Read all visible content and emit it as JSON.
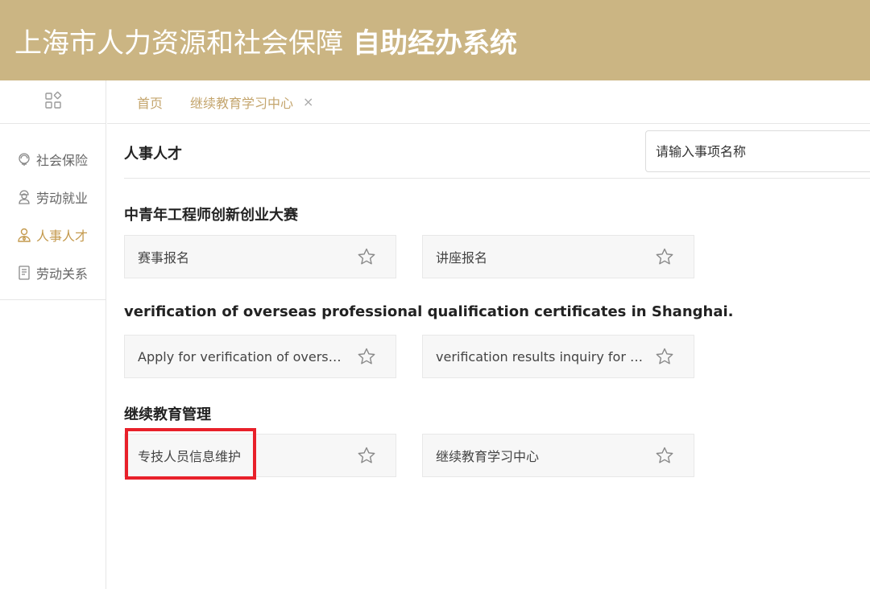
{
  "header": {
    "title_main": "上海市人力资源和社会保障",
    "title_bold": "自助经办系统"
  },
  "sidebar": {
    "top_icon": "grid-apps-icon",
    "items": [
      {
        "label": "社会保险",
        "icon": "insurance-icon",
        "active": false
      },
      {
        "label": "劳动就业",
        "icon": "worker-icon",
        "active": false
      },
      {
        "label": "人事人才",
        "icon": "person-icon",
        "active": true
      },
      {
        "label": "劳动关系",
        "icon": "document-icon",
        "active": false
      }
    ]
  },
  "tabs": [
    {
      "label": "首页"
    },
    {
      "label": "继续教育学习中心",
      "closable": true,
      "close_glyph": "×"
    }
  ],
  "main": {
    "category_title": "人事人才",
    "search_placeholder": "请输入事项名称",
    "sections": [
      {
        "title": "中青年工程师创新创业大赛",
        "items": [
          {
            "label": "赛事报名"
          },
          {
            "label": "讲座报名"
          }
        ]
      },
      {
        "title": "verification of overseas professional qualification certificates in Shanghai.",
        "items": [
          {
            "label": "Apply for verification of overse..."
          },
          {
            "label": "verification results inquiry for o..."
          }
        ]
      },
      {
        "title": "继续教育管理",
        "items": [
          {
            "label": "专技人员信息维护",
            "highlighted": true
          },
          {
            "label": "继续教育学习中心"
          }
        ]
      }
    ]
  },
  "colors": {
    "header_bg": "#cbb583",
    "accent": "#c49a4e",
    "highlight_border": "#e8202a"
  }
}
